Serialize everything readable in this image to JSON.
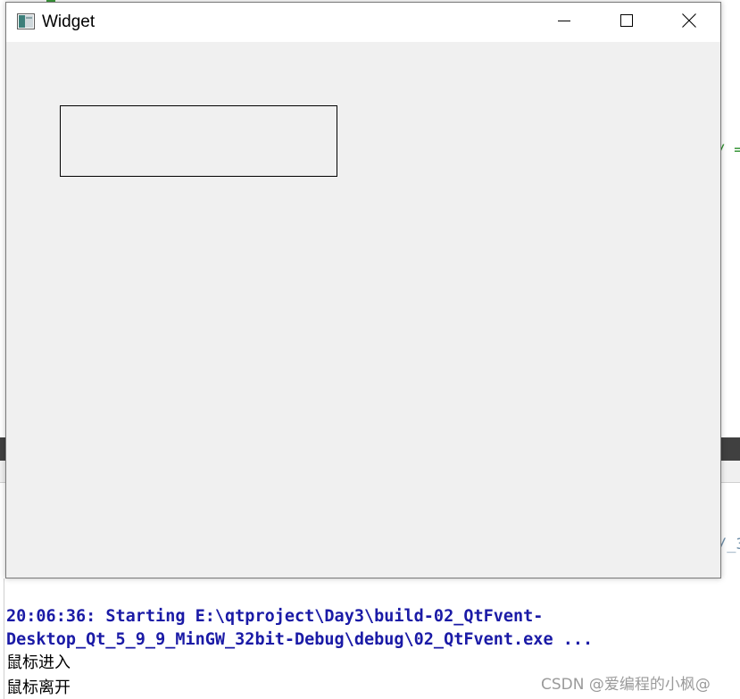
{
  "window": {
    "title": "Widget",
    "icons": {
      "app": "qt-window-icon",
      "minimize": "minimize-icon",
      "maximize": "maximize-icon",
      "close": "close-icon"
    }
  },
  "background": {
    "code_fragment_1": "/ =",
    "code_fragment_2": "/_3"
  },
  "console": {
    "start_line_1": "20:06:36: Starting E:\\qtproject\\Day3\\build-02_QtFvent-",
    "start_line_2": "Desktop_Qt_5_9_9_MinGW_32bit-Debug\\debug\\02_QtFvent.exe ...",
    "output": [
      "鼠标进入",
      "鼠标离开"
    ],
    "start_color": "#1a1aa6"
  },
  "watermark": "CSDN @爱编程的小枫@"
}
